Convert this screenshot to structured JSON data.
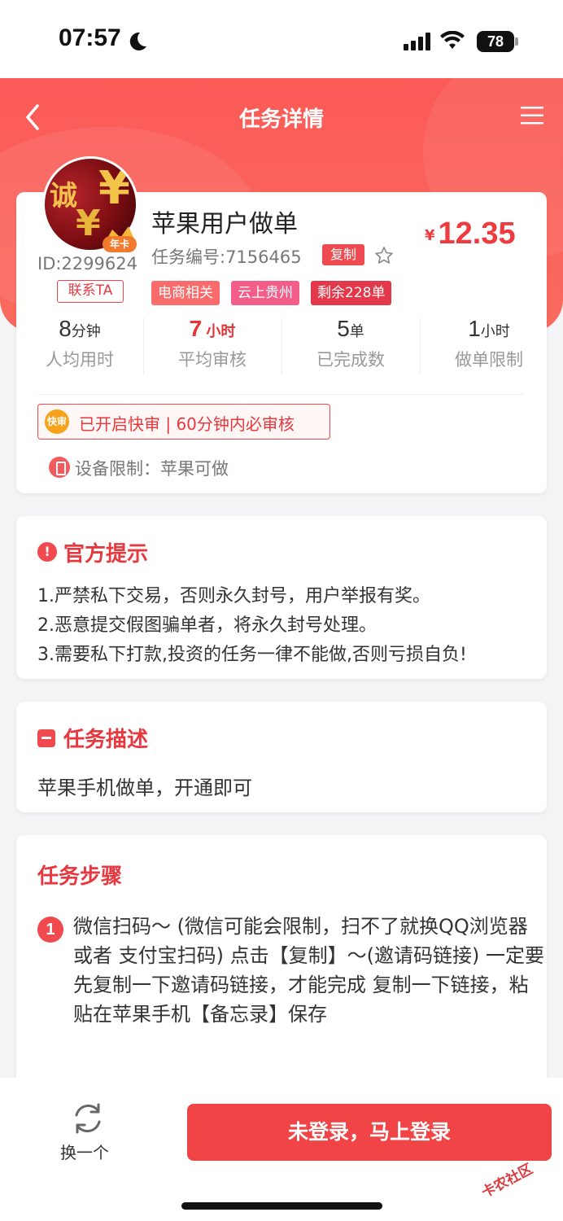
{
  "status_bar": {
    "time": "07:57",
    "battery": "78"
  },
  "header": {
    "title": "任务详情"
  },
  "user": {
    "badge": "年卡",
    "id_text": "ID:2299624",
    "contact_label": "联系TA"
  },
  "task": {
    "title": "苹果用户做单",
    "number_text": "任务编号:7156465",
    "copy_label": "复制",
    "price_symbol": "¥",
    "price": "12.35",
    "tags": [
      "电商相关",
      "云上贵州",
      "剩余228单"
    ]
  },
  "stats": [
    {
      "value": "8",
      "unit": "分钟",
      "label": "人均用时"
    },
    {
      "value": "7",
      "unit": "小时",
      "label": "平均审核"
    },
    {
      "value": "5",
      "unit": "单",
      "label": "已完成数"
    },
    {
      "value": "1",
      "unit": "小时",
      "label": "做单限制"
    }
  ],
  "fast_review": {
    "icon_label": "快审",
    "text": "已开启快审 | 60分钟内必审核"
  },
  "device_limit": "设备限制：苹果可做",
  "notice": {
    "title": "官方提示",
    "lines": [
      "1.严禁私下交易，否则永久封号，用户举报有奖。",
      "2.恶意提交假图骗单者，将永久封号处理。",
      "3.需要私下打款,投资的任务一律不能做,否则亏损自负!"
    ]
  },
  "description": {
    "title": "任务描述",
    "text": "苹果手机做单，开通即可"
  },
  "steps": {
    "title": "任务步骤",
    "items": [
      {
        "num": "1",
        "text": "微信扫码～ (微信可能会限制，扫不了就换QQ浏览器 或者 支付宝扫码) 点击【复制】～(邀请码链接) 一定要先复制一下邀请码链接，才能完成 复制一下链接，粘贴在苹果手机【备忘录】保存"
      }
    ]
  },
  "bottom": {
    "swap_label": "换一个",
    "login_label": "未登录，马上登录"
  },
  "watermark": "卡农社区",
  "colors": {
    "accent": "#f04446",
    "header": "#fb5a57"
  }
}
